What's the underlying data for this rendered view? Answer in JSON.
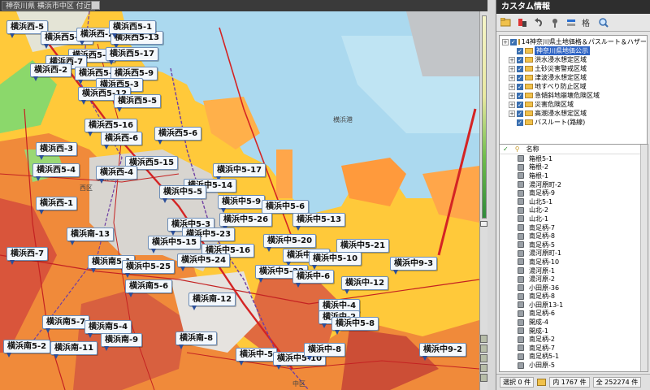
{
  "map_window": {
    "tab_title": "神奈川県 横浜市中区 付近",
    "place_labels": {
      "harbor": "横浜港",
      "nishi_ku": "西区",
      "ward_city": "横浜市",
      "bottom": "中区"
    },
    "pins": [
      "横浜西-5",
      "横浜西5-10",
      "横浜西-2",
      "横浜西5-13",
      "横浜西5-1",
      "横浜西5-8",
      "横浜西-7",
      "横浜西5-17",
      "横浜西-2",
      "横浜西5-18",
      "横浜西5-9",
      "横浜西5-3",
      "横浜西5-12",
      "横浜西5-5",
      "横浜西5-16",
      "横浜西5-6",
      "横浜西-6",
      "横浜西-3",
      "横浜西5-15",
      "横浜西5-4",
      "横浜西-4",
      "横浜中5-17",
      "横浜中5-14",
      "横浜中5-5",
      "横浜中5-9",
      "横浜中5-6",
      "横浜西-1",
      "横浜中5-13",
      "横浜中5-26",
      "横浜中5-3",
      "横浜中5-23",
      "横浜南-13",
      "横浜中5-20",
      "横浜中5-15",
      "横浜中5-21",
      "横浜中5-16",
      "横浜西-7",
      "横浜中5-7",
      "横浜中5-10",
      "横浜南5-1",
      "横浜中5-25",
      "横浜中5-24",
      "横浜中9-3",
      "横浜中5-22",
      "横浜中-6",
      "横浜中-12",
      "横浜南5-6",
      "横浜南-12",
      "横浜中-4",
      "横浜中-2",
      "横浜南5-7",
      "横浜中5-8",
      "横浜南5-4",
      "横浜南-9",
      "横浜南-8",
      "横浜南5-2",
      "横浜南-11",
      "横浜中-5",
      "横浜中5-10",
      "横浜中-8",
      "横浜中9-2"
    ]
  },
  "side_panel": {
    "header": "カスタム情報",
    "layers": [
      {
        "label": "14神奈川県土地価格＆パスルート＆ハザードrcm",
        "checked": true,
        "expandable": true
      },
      {
        "label": "神奈川県地価公示",
        "checked": true,
        "expandable": false,
        "selected": true
      },
      {
        "label": "洪水浸水想定区域",
        "checked": true,
        "expandable": true
      },
      {
        "label": "土砂災害警戒区域",
        "checked": true,
        "expandable": true
      },
      {
        "label": "津波浸水想定区域",
        "checked": true,
        "expandable": true
      },
      {
        "label": "地すべり防止区域",
        "checked": true,
        "expandable": true
      },
      {
        "label": "急傾斜地崩壊危険区域",
        "checked": true,
        "expandable": true
      },
      {
        "label": "災害危険区域",
        "checked": true,
        "expandable": true
      },
      {
        "label": "高潮浸水想定区域",
        "checked": true,
        "expandable": true
      },
      {
        "label": "バスルート(路線)",
        "checked": true,
        "expandable": false
      }
    ],
    "list_header": "名称",
    "features": [
      "箱根5-1",
      "箱根-2",
      "箱根-1",
      "湯河原町-2",
      "南足柄-9",
      "山北5-1",
      "山北-2",
      "山北-1",
      "南足柄-7",
      "南足柄-8",
      "南足柄-5",
      "湯河原町-1",
      "南足柄-10",
      "湯河原-1",
      "湯河原-2",
      "小田原-36",
      "南足柄-8",
      "小田原13-1",
      "南足柄-6",
      "開成-4",
      "開成-1",
      "南足柄-2",
      "南足柄-7",
      "南足柄5-1",
      "小田原-5"
    ],
    "status": {
      "selected": "選択 0 件",
      "inner": "内 1767 件",
      "total": "全 252274 件"
    }
  }
}
